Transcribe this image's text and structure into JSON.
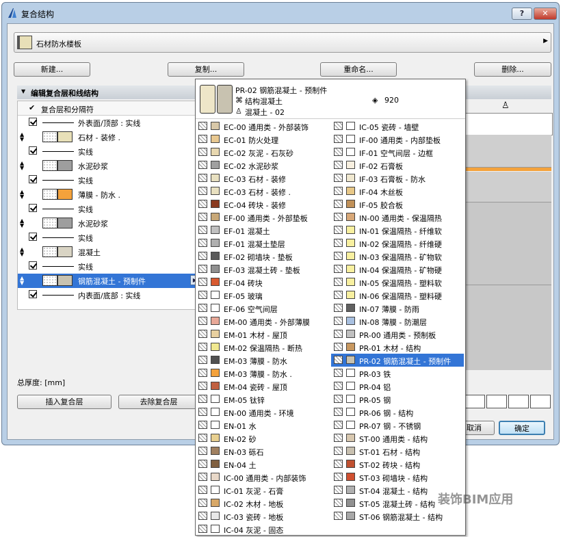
{
  "window": {
    "title": "复合结构",
    "help_label": "?",
    "close_label": "✕"
  },
  "composite": {
    "name": "石材防水楼板"
  },
  "buttons": {
    "new": "新建...",
    "copy": "复制...",
    "rename": "重命名...",
    "delete": "删除...",
    "insert": "插入复合层",
    "remove": "去除复合层",
    "cancel": "取消",
    "ok": "确定"
  },
  "section": {
    "title": "编辑复合层和线结构"
  },
  "list": {
    "header": "复合层和分隔符",
    "rows": [
      {
        "type": "line",
        "label": "外表面/顶部 : 实线"
      },
      {
        "type": "layer",
        "label": "石材 - 装修 .",
        "color": "#e8e0b8"
      },
      {
        "type": "line",
        "label": "实线"
      },
      {
        "type": "layer",
        "label": "水泥砂浆",
        "color": "#9e9e9e"
      },
      {
        "type": "line",
        "label": "实线"
      },
      {
        "type": "layer",
        "label": "薄膜 - 防水 .",
        "color": "#f4a23c"
      },
      {
        "type": "line",
        "label": "实线"
      },
      {
        "type": "layer",
        "label": "水泥砂浆",
        "color": "#9e9e9e"
      },
      {
        "type": "line",
        "label": "实线"
      },
      {
        "type": "layer",
        "label": "混凝土",
        "color": "#d9d4c4"
      },
      {
        "type": "line",
        "label": "实线"
      },
      {
        "type": "layer",
        "label": "钢筋混凝土 - 预制件",
        "color": "#c8c2b0",
        "selected": true
      },
      {
        "type": "line",
        "label": "内表面/底部 : 实线"
      }
    ]
  },
  "total_thickness_label": "总厚度: [mm]",
  "popup": {
    "current": {
      "code": "PR-02 钢筋混凝土 - 预制件",
      "material": "结构混凝土",
      "pen": "混凝土 - 02",
      "priority": "920"
    },
    "left_items": [
      {
        "label": "EC-00 通用类 - 外部装饰",
        "c": "#d8c8a8"
      },
      {
        "label": "EC-01 防火处理",
        "c": "#e8c890"
      },
      {
        "label": "EC-02 灰泥 - 石灰砂",
        "c": "#e8d8b0"
      },
      {
        "label": "EC-02 水泥砂浆",
        "c": "#a0a0a0"
      },
      {
        "label": "EC-03 石材 - 装修",
        "c": "#e8e0c0"
      },
      {
        "label": "EC-03 石材 - 装修 .",
        "c": "#e8e0c0"
      },
      {
        "label": "EC-04 砖块 - 装修",
        "c": "#8a3a20"
      },
      {
        "label": "EF-00 通用类 - 外部垫板",
        "c": "#c8a878"
      },
      {
        "label": "EF-01 混凝土",
        "c": "#c0c0c0"
      },
      {
        "label": "EF-01 混凝土垫层",
        "c": "#b0b0b0"
      },
      {
        "label": "EF-02 砌墙块 - 垫板",
        "c": "#5a5a5a"
      },
      {
        "label": "EF-03 混凝土砖 - 垫板",
        "c": "#909090"
      },
      {
        "label": "EF-04 砖块",
        "c": "#d85a30"
      },
      {
        "label": "EF-05 玻璃",
        "c": "#ffffff"
      },
      {
        "label": "EF-06 空气间层",
        "c": "#ffffff"
      },
      {
        "label": "EM-00 通用类 - 外部薄膜",
        "c": "#e8a898"
      },
      {
        "label": "EM-01 木材 - 屋顶",
        "c": "#e8d0a0"
      },
      {
        "label": "EM-02 保温隔热 - 断热",
        "c": "#f0e890"
      },
      {
        "label": "EM-03 薄膜 - 防水",
        "c": "#505050"
      },
      {
        "label": "EM-03 薄膜 - 防水 .",
        "c": "#f4a23c"
      },
      {
        "label": "EM-04 瓷砖 - 屋顶",
        "c": "#c06040"
      },
      {
        "label": "EM-05 钛锌",
        "c": "#ffffff"
      },
      {
        "label": "EN-00 通用类 - 环境",
        "c": "#ffffff"
      },
      {
        "label": "EN-01 水",
        "c": "#ffffff"
      },
      {
        "label": "EN-02 砂",
        "c": "#e8d090"
      },
      {
        "label": "EN-03 砾石",
        "c": "#a08060"
      },
      {
        "label": "EN-04 土",
        "c": "#806040"
      },
      {
        "label": "IC-00 通用类 - 内部装饰",
        "c": "#e8d8c8"
      },
      {
        "label": "IC-01 灰泥 - 石膏",
        "c": "#ffffff"
      },
      {
        "label": "IC-02 木材 - 地板",
        "c": "#d8a868"
      },
      {
        "label": "IC-03 瓷砖 - 地板",
        "c": "#e8e8e8"
      },
      {
        "label": "IC-04 灰泥 - 固态",
        "c": "#ffffff"
      }
    ],
    "right_items": [
      {
        "label": "IC-05 瓷砖 - 墙壁",
        "c": "#ffffff"
      },
      {
        "label": "IF-00 通用类 - 内部垫板",
        "c": "#ffffff"
      },
      {
        "label": "IF-01 空气间层 - 边框",
        "c": "#ffffff"
      },
      {
        "label": "IF-02 石膏板",
        "c": "#f8f0e0"
      },
      {
        "label": "IF-03 石膏板 - 防水",
        "c": "#f0e8d0"
      },
      {
        "label": "IF-04 木丝板",
        "c": "#e8c888"
      },
      {
        "label": "IF-05 胶合板",
        "c": "#c09058"
      },
      {
        "label": "IN-00 通用类 - 保温隔热",
        "c": "#d8a878"
      },
      {
        "label": "IN-01 保温隔热 - 纤维软",
        "c": "#f8f0a0"
      },
      {
        "label": "IN-02 保温隔热 - 纤维硬",
        "c": "#f8f0a0"
      },
      {
        "label": "IN-03 保温隔热 - 矿物软",
        "c": "#f8f0a0"
      },
      {
        "label": "IN-04 保温隔热 - 矿物硬",
        "c": "#f8f0a0"
      },
      {
        "label": "IN-05 保温隔热 - 塑料软",
        "c": "#f8f0a0"
      },
      {
        "label": "IN-06 保温隔热 - 塑料硬",
        "c": "#f8f0a0"
      },
      {
        "label": "IN-07 薄膜 - 防雨",
        "c": "#606060"
      },
      {
        "label": "IN-08 薄膜 - 防潮层",
        "c": "#a8c0e0"
      },
      {
        "label": "PR-00 通用类 - 预制板",
        "c": "#c0c0c0"
      },
      {
        "label": "PR-01 木材 - 结构",
        "c": "#c89860"
      },
      {
        "label": "PR-02 钢筋混凝土 - 预制件",
        "c": "#c8c2b0",
        "selected": true
      },
      {
        "label": "PR-03 铁",
        "c": "#ffffff"
      },
      {
        "label": "PR-04 铝",
        "c": "#ffffff"
      },
      {
        "label": "PR-05 钢",
        "c": "#ffffff"
      },
      {
        "label": "PR-06 钢 - 结构",
        "c": "#ffffff"
      },
      {
        "label": "PR-07 钢 - 不锈钢",
        "c": "#ffffff"
      },
      {
        "label": "ST-00 通用类 - 结构",
        "c": "#d8c8b0"
      },
      {
        "label": "ST-01 石材 - 结构",
        "c": "#c8c0b0"
      },
      {
        "label": "ST-02 砖块 - 结构",
        "c": "#c05030"
      },
      {
        "label": "ST-03 砌墙块 - 结构",
        "c": "#d05030"
      },
      {
        "label": "ST-04 混凝土 - 结构",
        "c": "#b0b0b0"
      },
      {
        "label": "ST-05 混凝土砖 - 结构",
        "c": "#909090"
      },
      {
        "label": "ST-06 钢筋混凝土 - 结构",
        "c": "#a8a8a8"
      }
    ]
  },
  "watermark": "装饰BIM应用"
}
